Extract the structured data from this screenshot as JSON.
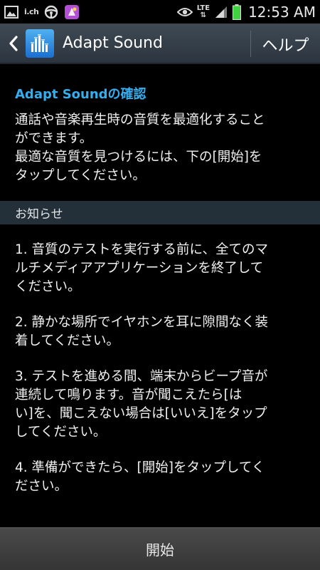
{
  "status_bar": {
    "carrier_label": "i.ch",
    "network_type": "LTE",
    "time": "12:53 AM",
    "icons": [
      "gallery-icon",
      "ich-icon",
      "steering-wheel-icon",
      "app-icon",
      "eye-icon",
      "signal-icon",
      "battery-icon"
    ],
    "battery_color": "#3fd43f"
  },
  "action_bar": {
    "title": "Adapt Sound",
    "help_label": "ヘルプ",
    "icon": "equalizer-icon",
    "accent": "#2a86e0"
  },
  "intro": {
    "title": "Adapt Soundの確認",
    "title_color": "#35aef0",
    "lines": [
      "通話や音楽再生時の音質を最適化すること",
      "ができます。",
      "最適な音質を見つけるには、下の[開始]を",
      "タップしてください。"
    ]
  },
  "notice": {
    "header": "お知らせ",
    "items": [
      {
        "lines": [
          "1. 音質のテストを実行する前に、全てのマ",
          "ルチメディアアプリケーションを終了して",
          "ください。"
        ]
      },
      {
        "lines": [
          "2. 静かな場所でイヤホンを耳に隙間なく装",
          "着してください。"
        ]
      },
      {
        "lines": [
          "3. テストを進める間、端末からビープ音が",
          "連続して鳴ります。音が聞こえたら[は",
          "い]を、聞こえない場合は[いいえ]をタップ",
          "してください。"
        ]
      },
      {
        "lines": [
          "4. 準備ができたら、[開始]をタップしてく",
          "ださい。"
        ]
      }
    ]
  },
  "footer": {
    "start_label": "開始"
  }
}
